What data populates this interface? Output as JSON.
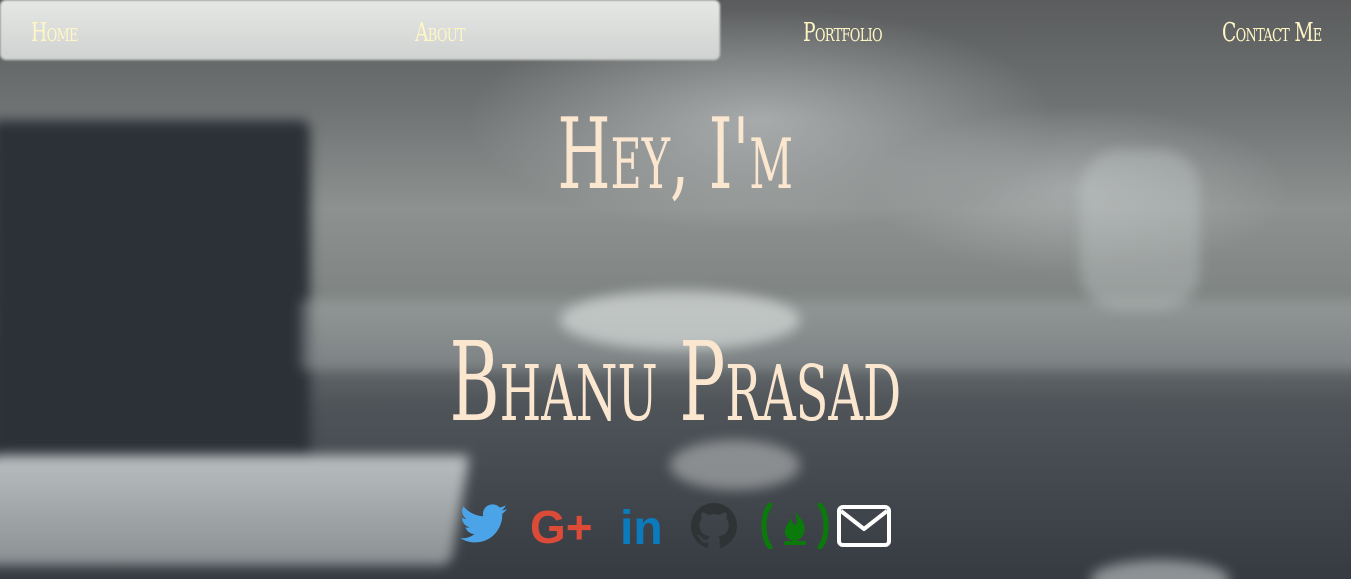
{
  "nav": {
    "home": "Home",
    "about": "About",
    "portfolio": "Portfolio",
    "contact": "Contact Me"
  },
  "hero": {
    "line1": "Hey, I'm",
    "line2": "Bhanu Prasad"
  },
  "social": {
    "googleplus_label": "G+",
    "linkedin_label": "in"
  },
  "colors": {
    "nav_text": "#fff6c4",
    "headline": "#fbe6cf",
    "twitter": "#4ba3e8",
    "googleplus": "#dc4a38",
    "linkedin": "#0a7bbd",
    "github": "#2f3336",
    "freecodecamp": "#0a7a0a",
    "mail": "#ffffff"
  },
  "icons": [
    "twitter-icon",
    "google-plus-icon",
    "linkedin-icon",
    "github-icon",
    "freecodecamp-icon",
    "mail-icon"
  ]
}
